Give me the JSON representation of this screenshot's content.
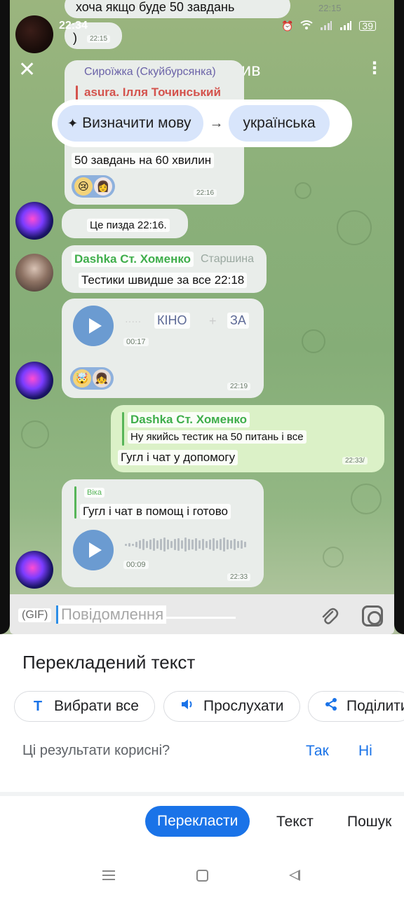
{
  "status_bar": {
    "time": "22:34",
    "battery": "39"
  },
  "lens": {
    "title": "Google Об'єктив",
    "source_language": "Визначити мову",
    "target_language": "українська"
  },
  "messages": [
    {
      "text": "хоча якщо буде 50 завдань",
      "time": "22:15"
    },
    {
      "text": ")",
      "time": "22:15"
    },
    {
      "reply_author": "Сироїжка (Скуйбурсянка)",
      "reply_sub": "asura. Ілля Точинський",
      "text": "50 завдань на 60 хвилин",
      "time": "22:16"
    },
    {
      "text": "Це пизда 22:16."
    },
    {
      "author": "Dashka Ст. Хоменко",
      "role": "Старшина",
      "text": "Тестики швидше за все 22:18"
    },
    {
      "voice_label_a": "КІНО",
      "voice_label_b": "ЗА",
      "duration": "00:17",
      "time": "22:19"
    },
    {
      "reply_author": "Dashka Ст. Хоменко",
      "reply_text": "Ну якийсь тестик на 50 питань і все",
      "text": "Гугл і чат у допомогу",
      "time": "22:33/"
    },
    {
      "reply_author": "Віка",
      "text": "Гугл і чат в помощ і готово",
      "duration": "00:09",
      "time": "22:33"
    }
  ],
  "input": {
    "gif": "(GIF)",
    "placeholder": "Повідомлення"
  },
  "sheet": {
    "title": "Перекладений текст",
    "select_all": "Вибрати все",
    "listen": "Прослухати",
    "share": "Поділити",
    "feedback_question": "Ці результати корисні?",
    "yes": "Так",
    "no": "Ні"
  },
  "tabs": {
    "translate": "Перекласти",
    "text": "Текст",
    "search": "Пошук"
  },
  "colors": {
    "accent": "#1a73e8",
    "chat_bg": "#8bb07a",
    "own_bubble": "#dbf1c7"
  }
}
